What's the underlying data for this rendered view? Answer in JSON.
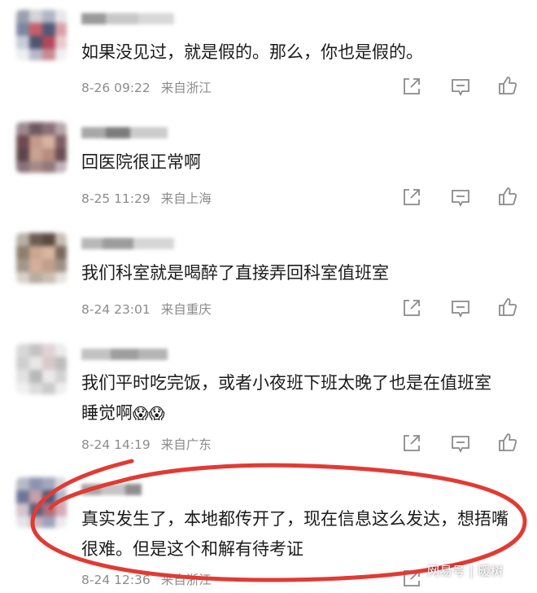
{
  "comments": [
    {
      "text": "如果没见过，就是假的。那么，你也是假的。",
      "time": "8-26 09:22",
      "location": "来自浙江"
    },
    {
      "text": "回医院很正常啊",
      "time": "8-25 11:29",
      "location": "来自上海"
    },
    {
      "text": "我们科室就是喝醉了直接弄回科室值班室",
      "time": "8-24 23:01",
      "location": "来自重庆"
    },
    {
      "text": "我们平时吃完饭，或者小夜班下班太晚了也是在值班室睡觉啊",
      "emoji": "😱😱",
      "time": "8-24 14:19",
      "location": "来自广东"
    },
    {
      "text": "真实发生了，本地都传开了，现在信息这么发达，想捂嘴很难。但是这个和解有待考证",
      "time": "8-24 12:36",
      "location": "来自浙江"
    }
  ],
  "actions": {
    "share_icon": "share-icon",
    "reply_icon": "comment-icon",
    "like_icon": "thumbs-up-icon"
  },
  "watermark": "网易号 | 暖树",
  "colors": {
    "text": "#1b1b1b",
    "meta": "#8c8c8c",
    "icon": "#8a8a8a",
    "highlight_circle": "#e23a33"
  }
}
